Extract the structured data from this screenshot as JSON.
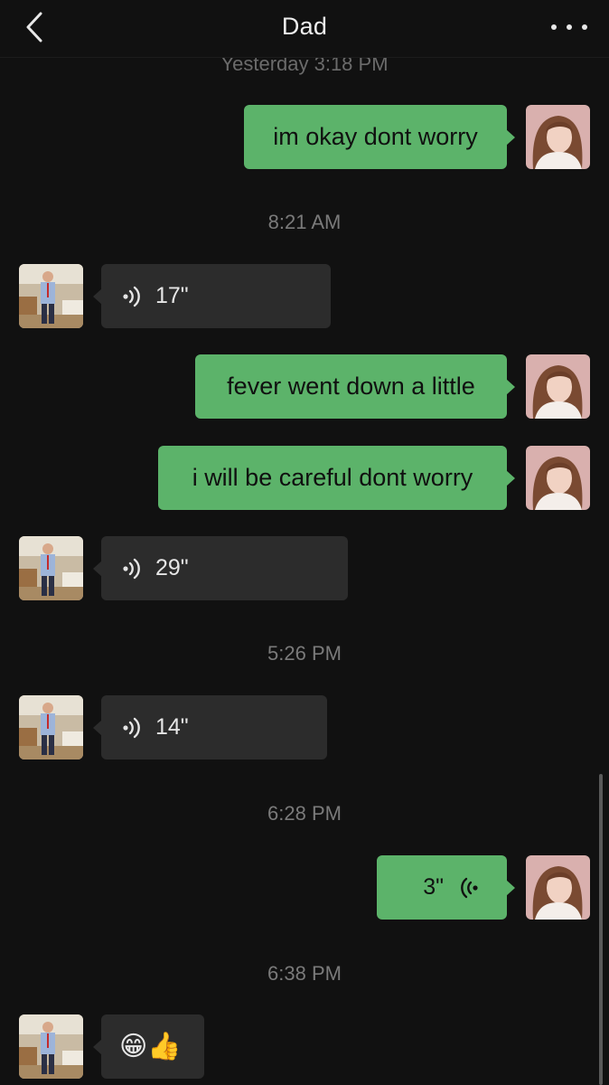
{
  "header": {
    "title": "Dad"
  },
  "timestamps": {
    "clipped": "Yesterday 3:18 PM",
    "t1": "8:21 AM",
    "t2": "5:26 PM",
    "t3": "6:28 PM",
    "t4": "6:38 PM"
  },
  "messages": [
    {
      "from": "me",
      "type": "text",
      "text": "im okay dont worry"
    },
    {
      "from": "Dad",
      "type": "voice",
      "duration": "17\""
    },
    {
      "from": "me",
      "type": "text",
      "text": "fever went down a little"
    },
    {
      "from": "me",
      "type": "text",
      "text": "i will be careful dont worry"
    },
    {
      "from": "Dad",
      "type": "voice",
      "duration": "29\""
    },
    {
      "from": "Dad",
      "type": "voice",
      "duration": "14\""
    },
    {
      "from": "me",
      "type": "voice",
      "duration": "3\""
    },
    {
      "from": "Dad",
      "type": "emoji",
      "text": "😁👍"
    }
  ],
  "colors": {
    "background": "#111111",
    "outgoing_bubble": "#5cb36a",
    "incoming_bubble": "#2c2c2c",
    "timestamp_text": "#7a7a7a"
  },
  "icons": {
    "back": "chevron-left-icon",
    "more": "more-dots-icon",
    "voice": "voice-wave-icon"
  }
}
